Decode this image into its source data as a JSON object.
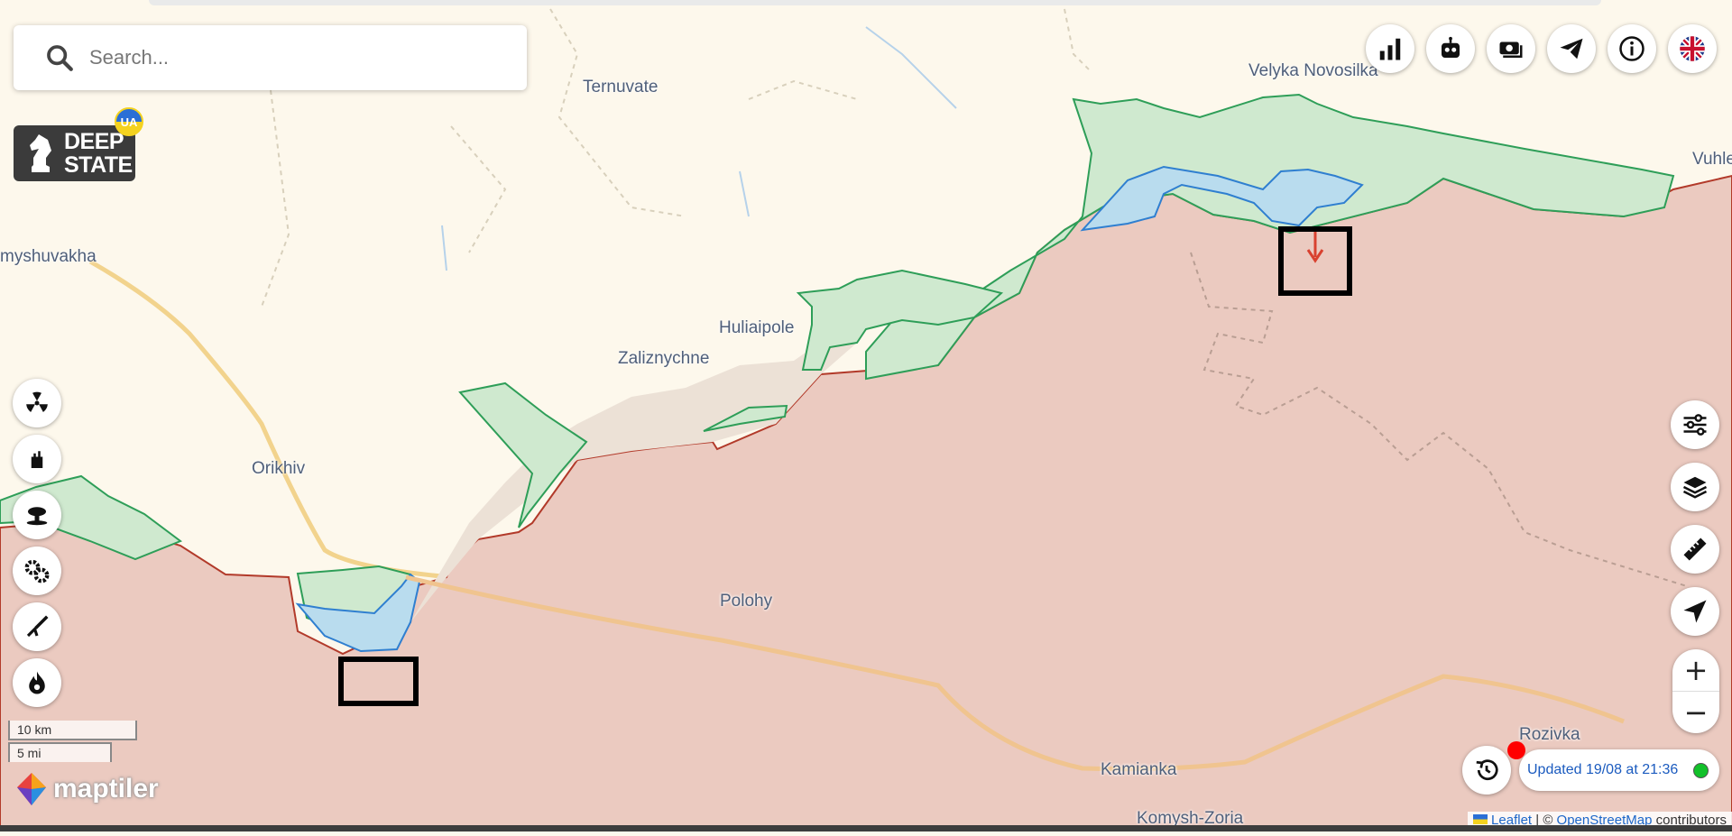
{
  "search": {
    "placeholder": "Search..."
  },
  "logo": {
    "line1": "DEEP",
    "line2": "STATE",
    "badge": "UA"
  },
  "places": [
    {
      "name": "Ternuvate"
    },
    {
      "name": "Velyka Novosilka"
    },
    {
      "name": "Vuhle"
    },
    {
      "name": "myshuvakha"
    },
    {
      "name": "Huliaipole"
    },
    {
      "name": "Zaliznychne"
    },
    {
      "name": "Orikhiv"
    },
    {
      "name": "Polohy"
    },
    {
      "name": "Rozivka"
    },
    {
      "name": "Kamianka"
    },
    {
      "name": "Komysh-Zoria"
    }
  ],
  "scale": {
    "metric": "10 km",
    "imperial": "5 mi"
  },
  "maptiler_label": "maptiler",
  "status": {
    "updated": "Updated 19/08 at 21:36"
  },
  "attribution": {
    "leaflet": "Leaflet",
    "sep": " | © ",
    "osm": "OpenStreetMap",
    "suffix": " contributors"
  },
  "zoom": {
    "in": "+",
    "out": "−"
  },
  "colors": {
    "occupied": "#ebcac0",
    "occupied_border": "#b23a2a",
    "liberated": "#cfe9cf",
    "liberated_border": "#2e9e58",
    "contested": "#b9dcee",
    "contested_border": "#2f7fd0",
    "free": "#fdf8ec",
    "updated_text": "#1b5bbf",
    "status_online": "#12c12a"
  }
}
